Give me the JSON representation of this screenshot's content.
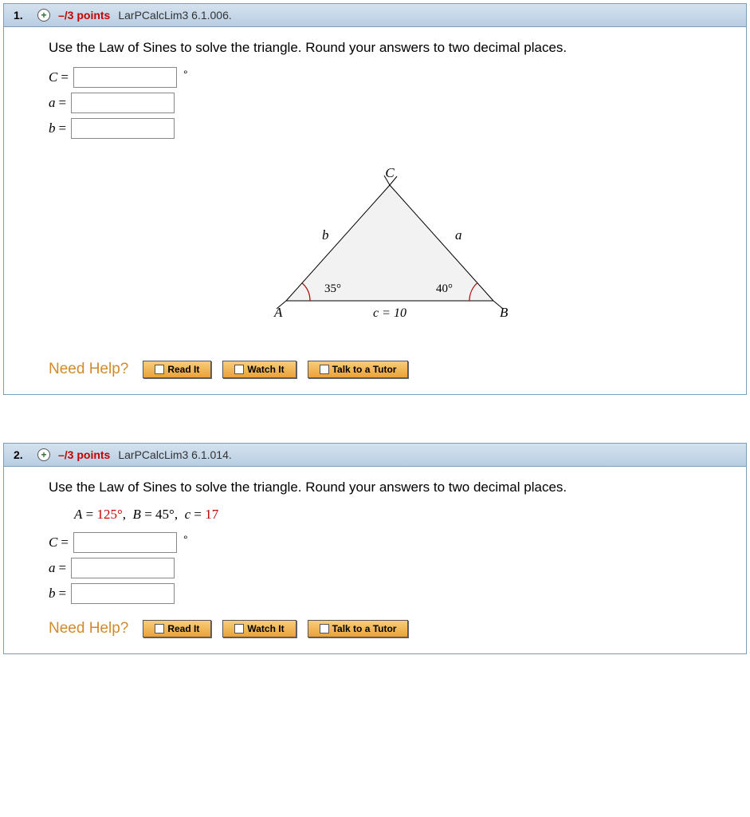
{
  "questions": [
    {
      "number": "1.",
      "points": "–/3 points",
      "source": "LarPCalcLim3 6.1.006.",
      "prompt": "Use the Law of Sines to solve the triangle. Round your answers to two decimal places.",
      "answers": {
        "C_label": "C",
        "a_label": "a",
        "b_label": "b"
      },
      "triangle": {
        "vertex_A": "A",
        "vertex_B": "B",
        "vertex_C": "C",
        "side_a": "a",
        "side_b": "b",
        "side_c": "c = 10",
        "angle_A": "35°",
        "angle_B": "40°"
      },
      "help": {
        "title": "Need Help?",
        "read": "Read It",
        "watch": "Watch It",
        "tutor": "Talk to a Tutor"
      }
    },
    {
      "number": "2.",
      "points": "–/3 points",
      "source": "LarPCalcLim3 6.1.014.",
      "prompt": "Use the Law of Sines to solve the triangle. Round your answers to two decimal places.",
      "given": {
        "A_lbl": "A",
        "A_val": "125°",
        "B_lbl": "B",
        "B_val": "45°",
        "c_lbl": "c",
        "c_val": "17"
      },
      "answers": {
        "C_label": "C",
        "a_label": "a",
        "b_label": "b"
      },
      "help": {
        "title": "Need Help?",
        "read": "Read It",
        "watch": "Watch It",
        "tutor": "Talk to a Tutor"
      }
    }
  ],
  "chart_data": {
    "type": "diagram",
    "description": "Triangle with vertices A (bottom-left), B (bottom-right), C (top). Angle at A = 35°, angle at B = 40°, base side c = 10 between A and B. Side b from A to C, side a from C to B."
  }
}
